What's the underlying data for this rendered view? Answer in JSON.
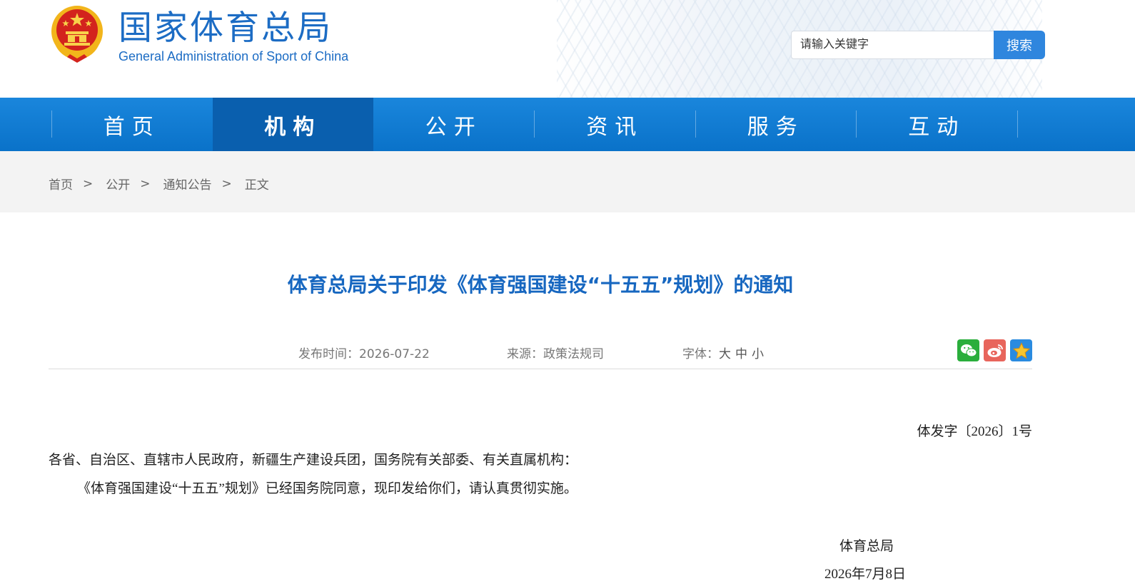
{
  "header": {
    "title_cn": "国家体育总局",
    "title_en": "General Administration of Sport of China",
    "search": {
      "placeholder": "请输入关键字",
      "button_label": "搜索"
    }
  },
  "nav": {
    "items": [
      {
        "label": "首页",
        "active": false
      },
      {
        "label": "机构",
        "active": true
      },
      {
        "label": "公开",
        "active": false
      },
      {
        "label": "资讯",
        "active": false
      },
      {
        "label": "服务",
        "active": false
      },
      {
        "label": "互动",
        "active": false
      }
    ]
  },
  "breadcrumb": {
    "items": [
      "首页",
      "公开",
      "通知公告",
      "正文"
    ],
    "separator": ">"
  },
  "article": {
    "title": "体育总局关于印发《体育强国建设“十五五”规划》的通知",
    "meta": {
      "date_label": "发布时间：",
      "date_value": "2026-07-22",
      "source_label": "来源：",
      "source_value": "政策法规司",
      "font_label": "字体：",
      "font_large": "大",
      "font_medium": "中",
      "font_small": "小"
    },
    "share": [
      "wechat-icon",
      "weibo-icon",
      "favorite-icon"
    ],
    "doc_number": "体发字〔2026〕1号",
    "recipients": "各省、自治区、直辖市人民政府，新疆生产建设兵团，国务院有关部委、有关直属机构：",
    "body": "《体育强国建设“十五五”规划》已经国务院同意，现印发给你们，请认真贯彻实施。",
    "issuer": "体育总局",
    "issue_date": "2026年7月8日"
  },
  "colors": {
    "brand_blue": "#1c6cc4",
    "nav_blue": "#0a72c9",
    "nav_active": "#0a5fae",
    "search_button": "#2f86de",
    "title_blue": "#1767c0"
  }
}
